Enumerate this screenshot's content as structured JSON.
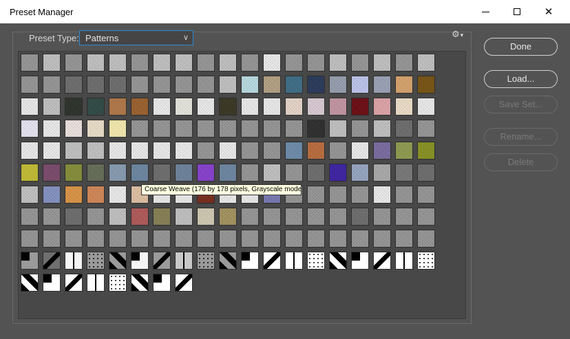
{
  "window": {
    "title": "Preset Manager"
  },
  "preset_type": {
    "label": "Preset Type:",
    "value": "Patterns"
  },
  "buttons": {
    "done": "Done",
    "load": "Load...",
    "save_set": "Save Set...",
    "rename": "Rename...",
    "delete": "Delete"
  },
  "tooltip": "Coarse Weave (176 by 178 pixels, Grayscale mode)",
  "grid": {
    "columns": 19,
    "rows": 11,
    "count": 198
  }
}
